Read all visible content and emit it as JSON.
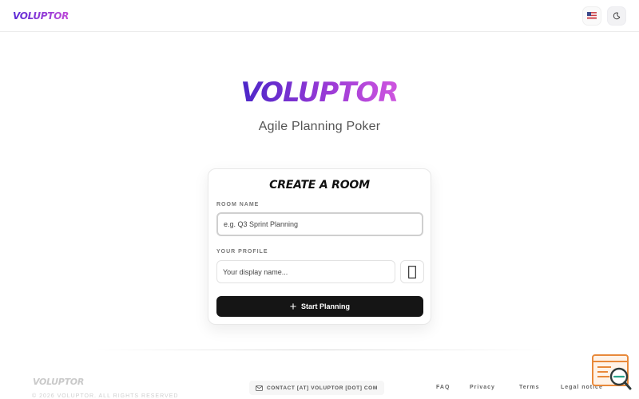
{
  "header": {
    "brand": "VOLUPTOR",
    "language_icon": "us-flag-icon",
    "theme_icon": "moon-icon"
  },
  "hero": {
    "logo": "VOLUPTOR",
    "tagline": "Agile Planning Poker"
  },
  "card": {
    "title": "CREATE A ROOM",
    "room_label": "ROOM NAME",
    "room_placeholder": "e.g. Q3 Sprint Planning",
    "profile_label": "YOUR PROFILE",
    "name_placeholder": "Your display name...",
    "avatar_icon": "avatar-placeholder-icon",
    "submit_label": "Start Planning",
    "submit_icon": "plus-icon"
  },
  "footer": {
    "brand": "VOLUPTOR",
    "copyright": "© 2026 VOLUPTOR. ALL RIGHTS RESERVED",
    "contact": "CONTACT [AT] VOLUPTOR [DOT] COM",
    "links": [
      "FAQ",
      "Privacy",
      "Terms",
      "Legal notice"
    ]
  },
  "colors": {
    "brand_gradient_start": "#4a26c8",
    "brand_gradient_end": "#cf56df",
    "button_bg": "#151515"
  }
}
